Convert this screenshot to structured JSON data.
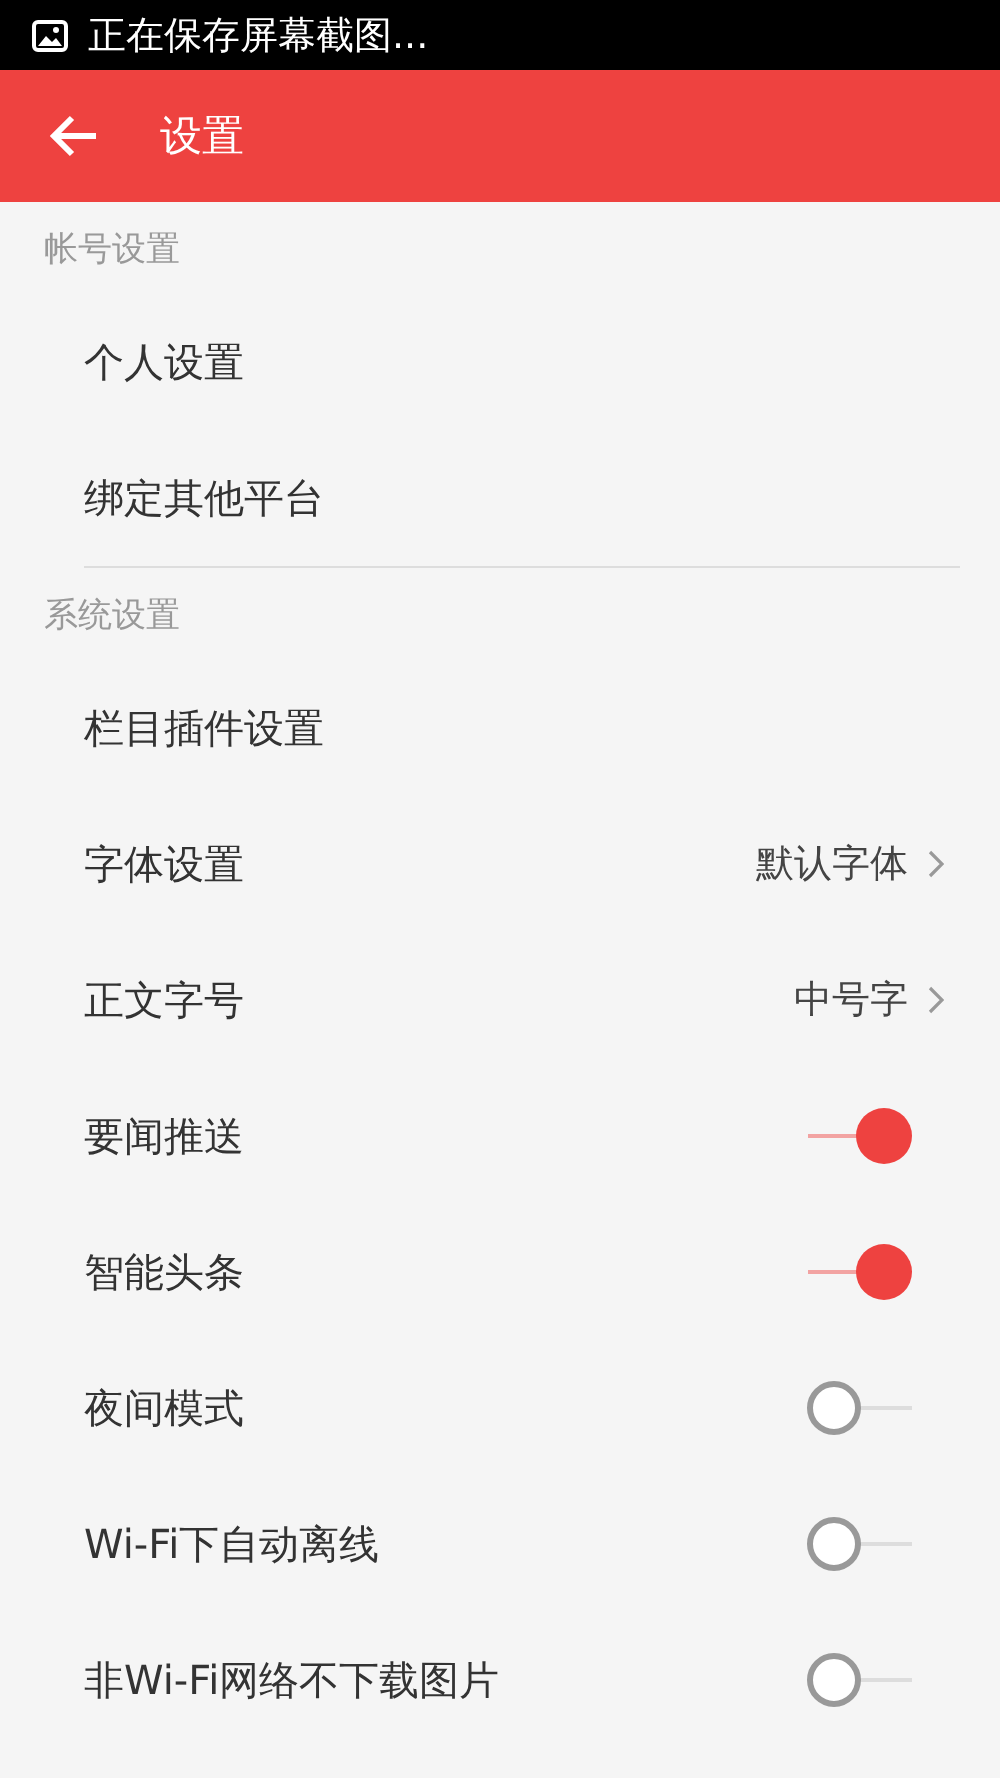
{
  "status_bar": {
    "text": "正在保存屏幕截图..."
  },
  "app_bar": {
    "title": "设置"
  },
  "sections": [
    {
      "title": "帐号设置",
      "items": [
        {
          "kind": "link",
          "label": "个人设置"
        },
        {
          "kind": "link",
          "label": "绑定其他平台"
        }
      ]
    },
    {
      "title": "系统设置",
      "items": [
        {
          "kind": "link",
          "label": "栏目插件设置"
        },
        {
          "kind": "value",
          "label": "字体设置",
          "value": "默认字体"
        },
        {
          "kind": "value",
          "label": "正文字号",
          "value": "中号字"
        },
        {
          "kind": "toggle",
          "label": "要闻推送",
          "on": true
        },
        {
          "kind": "toggle",
          "label": "智能头条",
          "on": true
        },
        {
          "kind": "toggle",
          "label": "夜间模式",
          "on": false
        },
        {
          "kind": "toggle",
          "label": "Wi-Fi下自动离线",
          "on": false
        },
        {
          "kind": "toggle",
          "label": "非Wi-Fi网络不下载图片",
          "on": false
        }
      ]
    }
  ]
}
